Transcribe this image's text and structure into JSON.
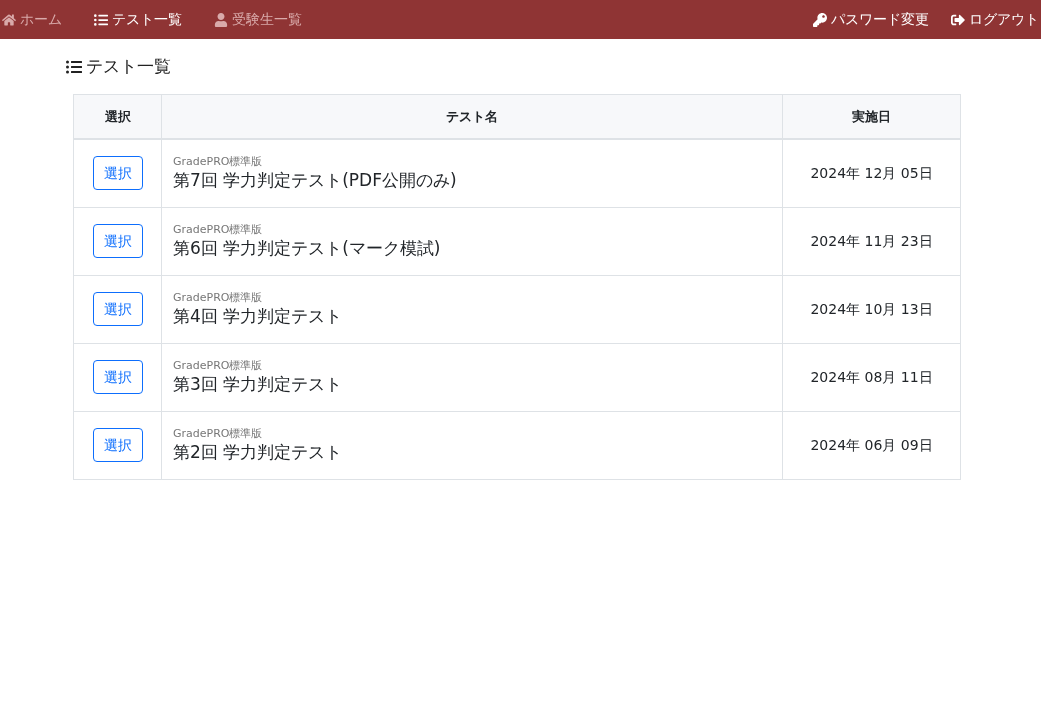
{
  "navbar": {
    "left_items": [
      {
        "kind": "home",
        "label": "ホーム",
        "selected": false
      },
      {
        "kind": "list",
        "label": "テスト一覧",
        "selected": true
      },
      {
        "kind": "user",
        "label": "受験生一覧",
        "selected": false
      }
    ],
    "right_items": [
      {
        "kind": "key",
        "label": "パスワード変更"
      },
      {
        "kind": "logout",
        "label": "ログアウト"
      }
    ]
  },
  "heading": "テスト一覧",
  "table": {
    "columns": [
      "選択",
      "テスト名",
      "実施日"
    ],
    "rows": [
      {
        "button": "選択",
        "edition": "GradePRO標準版",
        "name": "第7回 学力判定テスト(PDF公開のみ)",
        "date": "2024年 12月 05日"
      },
      {
        "button": "選択",
        "edition": "GradePRO標準版",
        "name": "第6回 学力判定テスト(マーク模試)",
        "date": "2024年 11月 23日"
      },
      {
        "button": "選択",
        "edition": "GradePRO標準版",
        "name": "第4回 学力判定テスト",
        "date": "2024年 10月 13日"
      },
      {
        "button": "選択",
        "edition": "GradePRO標準版",
        "name": "第3回 学力判定テスト",
        "date": "2024年 08月 11日"
      },
      {
        "button": "選択",
        "edition": "GradePRO標準版",
        "name": "第2回 学力判定テスト",
        "date": "2024年 06月 09日"
      }
    ]
  }
}
